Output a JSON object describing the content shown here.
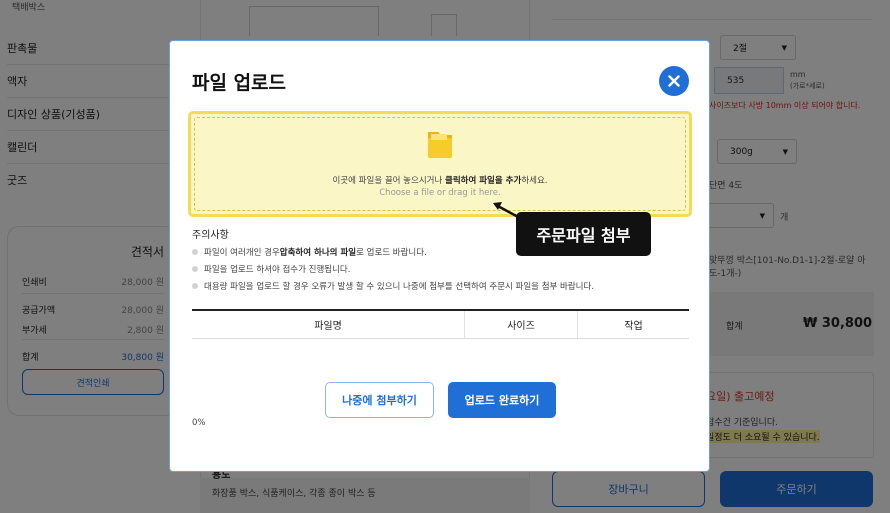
{
  "background": {
    "nav": {
      "top_label": "택배박스",
      "items": [
        "판촉물",
        "액자",
        "디자인 상품(기성품)",
        "캘린더",
        "굿즈"
      ]
    },
    "quote": {
      "title": "견적서",
      "rows": [
        {
          "label": "인쇄비",
          "value": "28,000 원"
        },
        {
          "label": "공급가액",
          "value": "28,000 원"
        },
        {
          "label": "부가세",
          "value": "2,800 원"
        },
        {
          "label": "합계",
          "value": "30,800 원"
        }
      ],
      "print_button": "견적인쇄"
    },
    "middle": {
      "caption_title": "용도",
      "caption_text": "화장품 박스, 식품케이스, 각종 종이 박스 등"
    },
    "right": {
      "select_fold": "2절",
      "size_value": "535",
      "size_unit": "mm",
      "size_hint": "(가로*세로)",
      "size_warning": "사이즈보다 사방 10mm 이상 되어야 합니다.",
      "paper_weight": "300g",
      "side_text": "단면 4도",
      "qty_unit": "개",
      "product_desc_1": "맞뚜껑 박스[101-No.D1-1]-2절-로얄 아",
      "product_desc_2": "도-1개-)",
      "total_label": "합계",
      "total_price": "₩ 30,800",
      "ship_title": "요일) 출고예정",
      "ship_line1": "접수건 기준입니다.",
      "ship_line2": "일정도 더 소요될 수 있습니다.",
      "cart_button": "장바구니",
      "order_button": "주문하기"
    }
  },
  "modal": {
    "title": "파일 업로드",
    "close_icon": "close-icon",
    "dropzone": {
      "main_prefix": "이곳에 파일을 끌어 놓으시거나 ",
      "main_bold": "클릭하여 파일을 추가",
      "main_suffix": "하세요.",
      "sub": "Choose a file or drag it here."
    },
    "notice_title": "주의사항",
    "notices": [
      {
        "prefix": "파일이 여러개인 경우 ",
        "bold": "압축하여 하나의 파일",
        "suffix": "로 업로드 바랍니다."
      },
      {
        "prefix": "파일을 업로드 하셔야 접수가 진행됩니다.",
        "bold": "",
        "suffix": ""
      },
      {
        "prefix": "대용량 파일을 업로드 할 경우 오류가 발생 할 수 있으니 나중에 첨부를 선택하여 주문시 파일을 첨부 바랍니다.",
        "bold": "",
        "suffix": ""
      }
    ],
    "table_headers": [
      "파일명",
      "사이즈",
      "작업"
    ],
    "later_button": "나중에 첨부하기",
    "done_button": "업로드 완료하기",
    "progress": "0%"
  },
  "callout": {
    "label": "주문파일 첨부"
  },
  "colors": {
    "accent": "#1f6fd6",
    "dropzone_bg": "#fbf6c6",
    "dropzone_border": "#f2dc55",
    "callout_bg": "#111111"
  }
}
